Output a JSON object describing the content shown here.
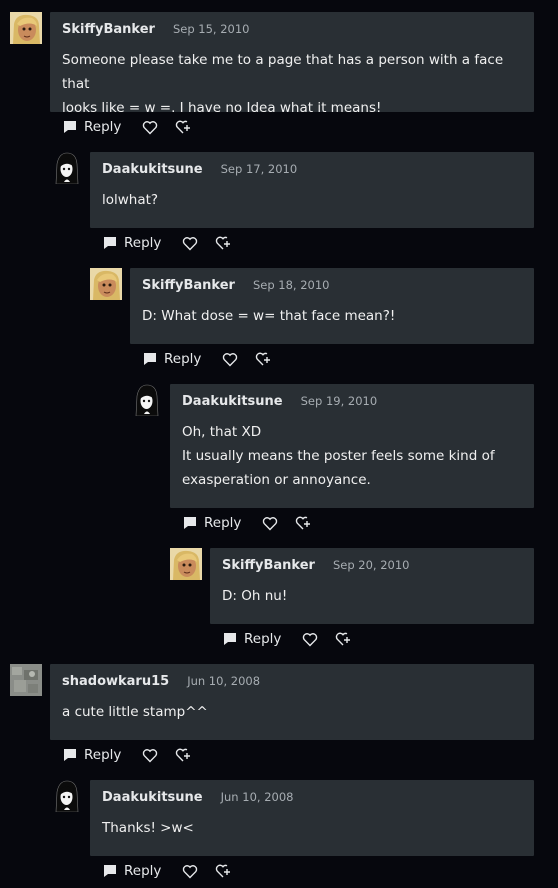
{
  "reply_label": "Reply",
  "comments": [
    {
      "author": "SkiffyBanker",
      "date": "Sep 15, 2010",
      "lines": [
        "Someone please take me to a page that has a person with a face that",
        "looks like = w =. I have no Idea what it means!"
      ],
      "avatar": "blonde-character"
    },
    {
      "author": "Daakukitsune",
      "date": "Sep 17, 2010",
      "lines": [
        "lolwhat?"
      ],
      "avatar": "black-hair-character"
    },
    {
      "author": "SkiffyBanker",
      "date": "Sep 18, 2010",
      "lines": [
        "D: What dose = w= that face mean?!"
      ],
      "avatar": "blonde-character"
    },
    {
      "author": "Daakukitsune",
      "date": "Sep 19, 2010",
      "lines": [
        "Oh, that XD",
        "It usually means the poster feels some kind of",
        "exasperation or annoyance."
      ],
      "avatar": "black-hair-character"
    },
    {
      "author": "SkiffyBanker",
      "date": "Sep 20, 2010",
      "lines": [
        "D: Oh nu!"
      ],
      "avatar": "blonde-character"
    },
    {
      "author": "shadowkaru15",
      "date": "Jun 10, 2008",
      "lines": [
        "a cute little stamp^^"
      ],
      "avatar": "grey-texture"
    },
    {
      "author": "Daakukitsune",
      "date": "Jun 10, 2008",
      "lines": [
        "Thanks! >w<"
      ],
      "avatar": "black-hair-character"
    }
  ],
  "colors": {
    "background": "#06070d",
    "bubble": "#292f34",
    "date": "#a7adb2"
  }
}
